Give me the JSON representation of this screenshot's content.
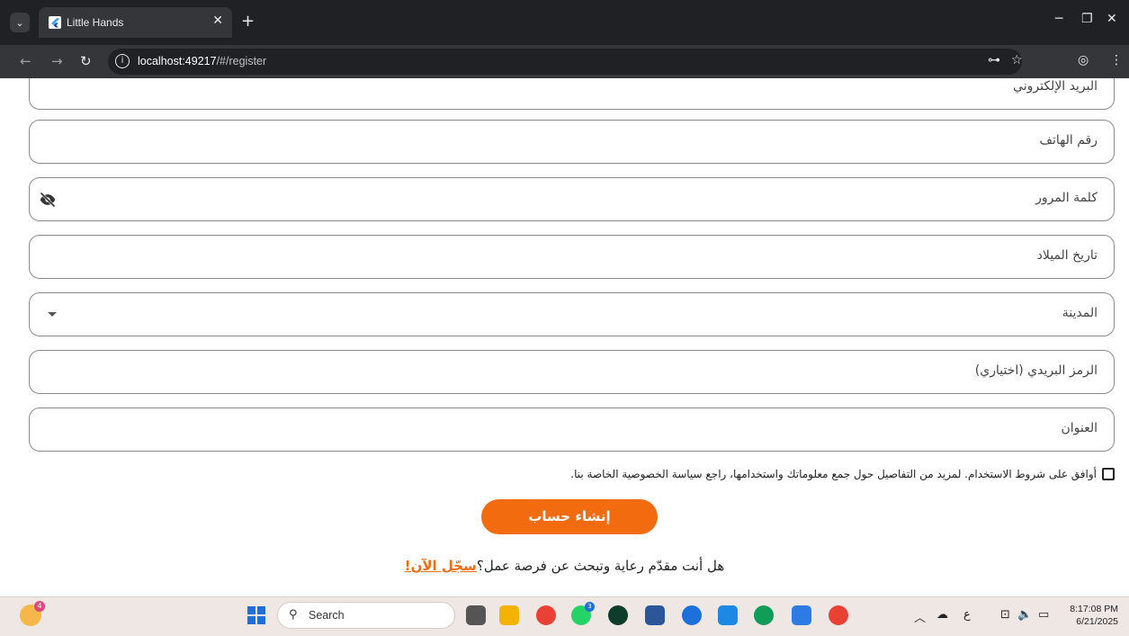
{
  "browser": {
    "tab_title": "Little Hands",
    "url_host": "localhost:49217",
    "url_path": "/#/register"
  },
  "form": {
    "fields": [
      {
        "label": "البريد الإلكتروني"
      },
      {
        "label": "رقم الهاتف"
      },
      {
        "label": "كلمة المرور",
        "icon": "eye-off-icon"
      },
      {
        "label": "تاريخ الميلاد"
      },
      {
        "label": "المدينة",
        "icon": "dropdown-arrow-icon"
      },
      {
        "label": "الرمز البريدي (اختياري)"
      },
      {
        "label": "العنوان"
      }
    ],
    "terms_text": "أوافق على شروط الاستخدام. لمزيد من التفاصيل حول جمع معلوماتك واستخدامها، راجع سياسة الخصوصية الخاصة بنا.",
    "terms_checked": false,
    "submit_label": "إنشاء حساب",
    "caregiver_prompt": "هل أنت مقدّم رعاية وتبحث عن فرصة عمل؟",
    "caregiver_link": "سجّل الآن!"
  },
  "taskbar": {
    "search_label": "Search",
    "widget_badge": "4",
    "whatsapp_badge": "3",
    "language_indicator": "ع",
    "time": "8:17:08 PM",
    "date": "6/21/2025"
  },
  "colors": {
    "accent": "#f26b0f",
    "chrome_dark": "#202124",
    "chrome_mid": "#35363a"
  }
}
